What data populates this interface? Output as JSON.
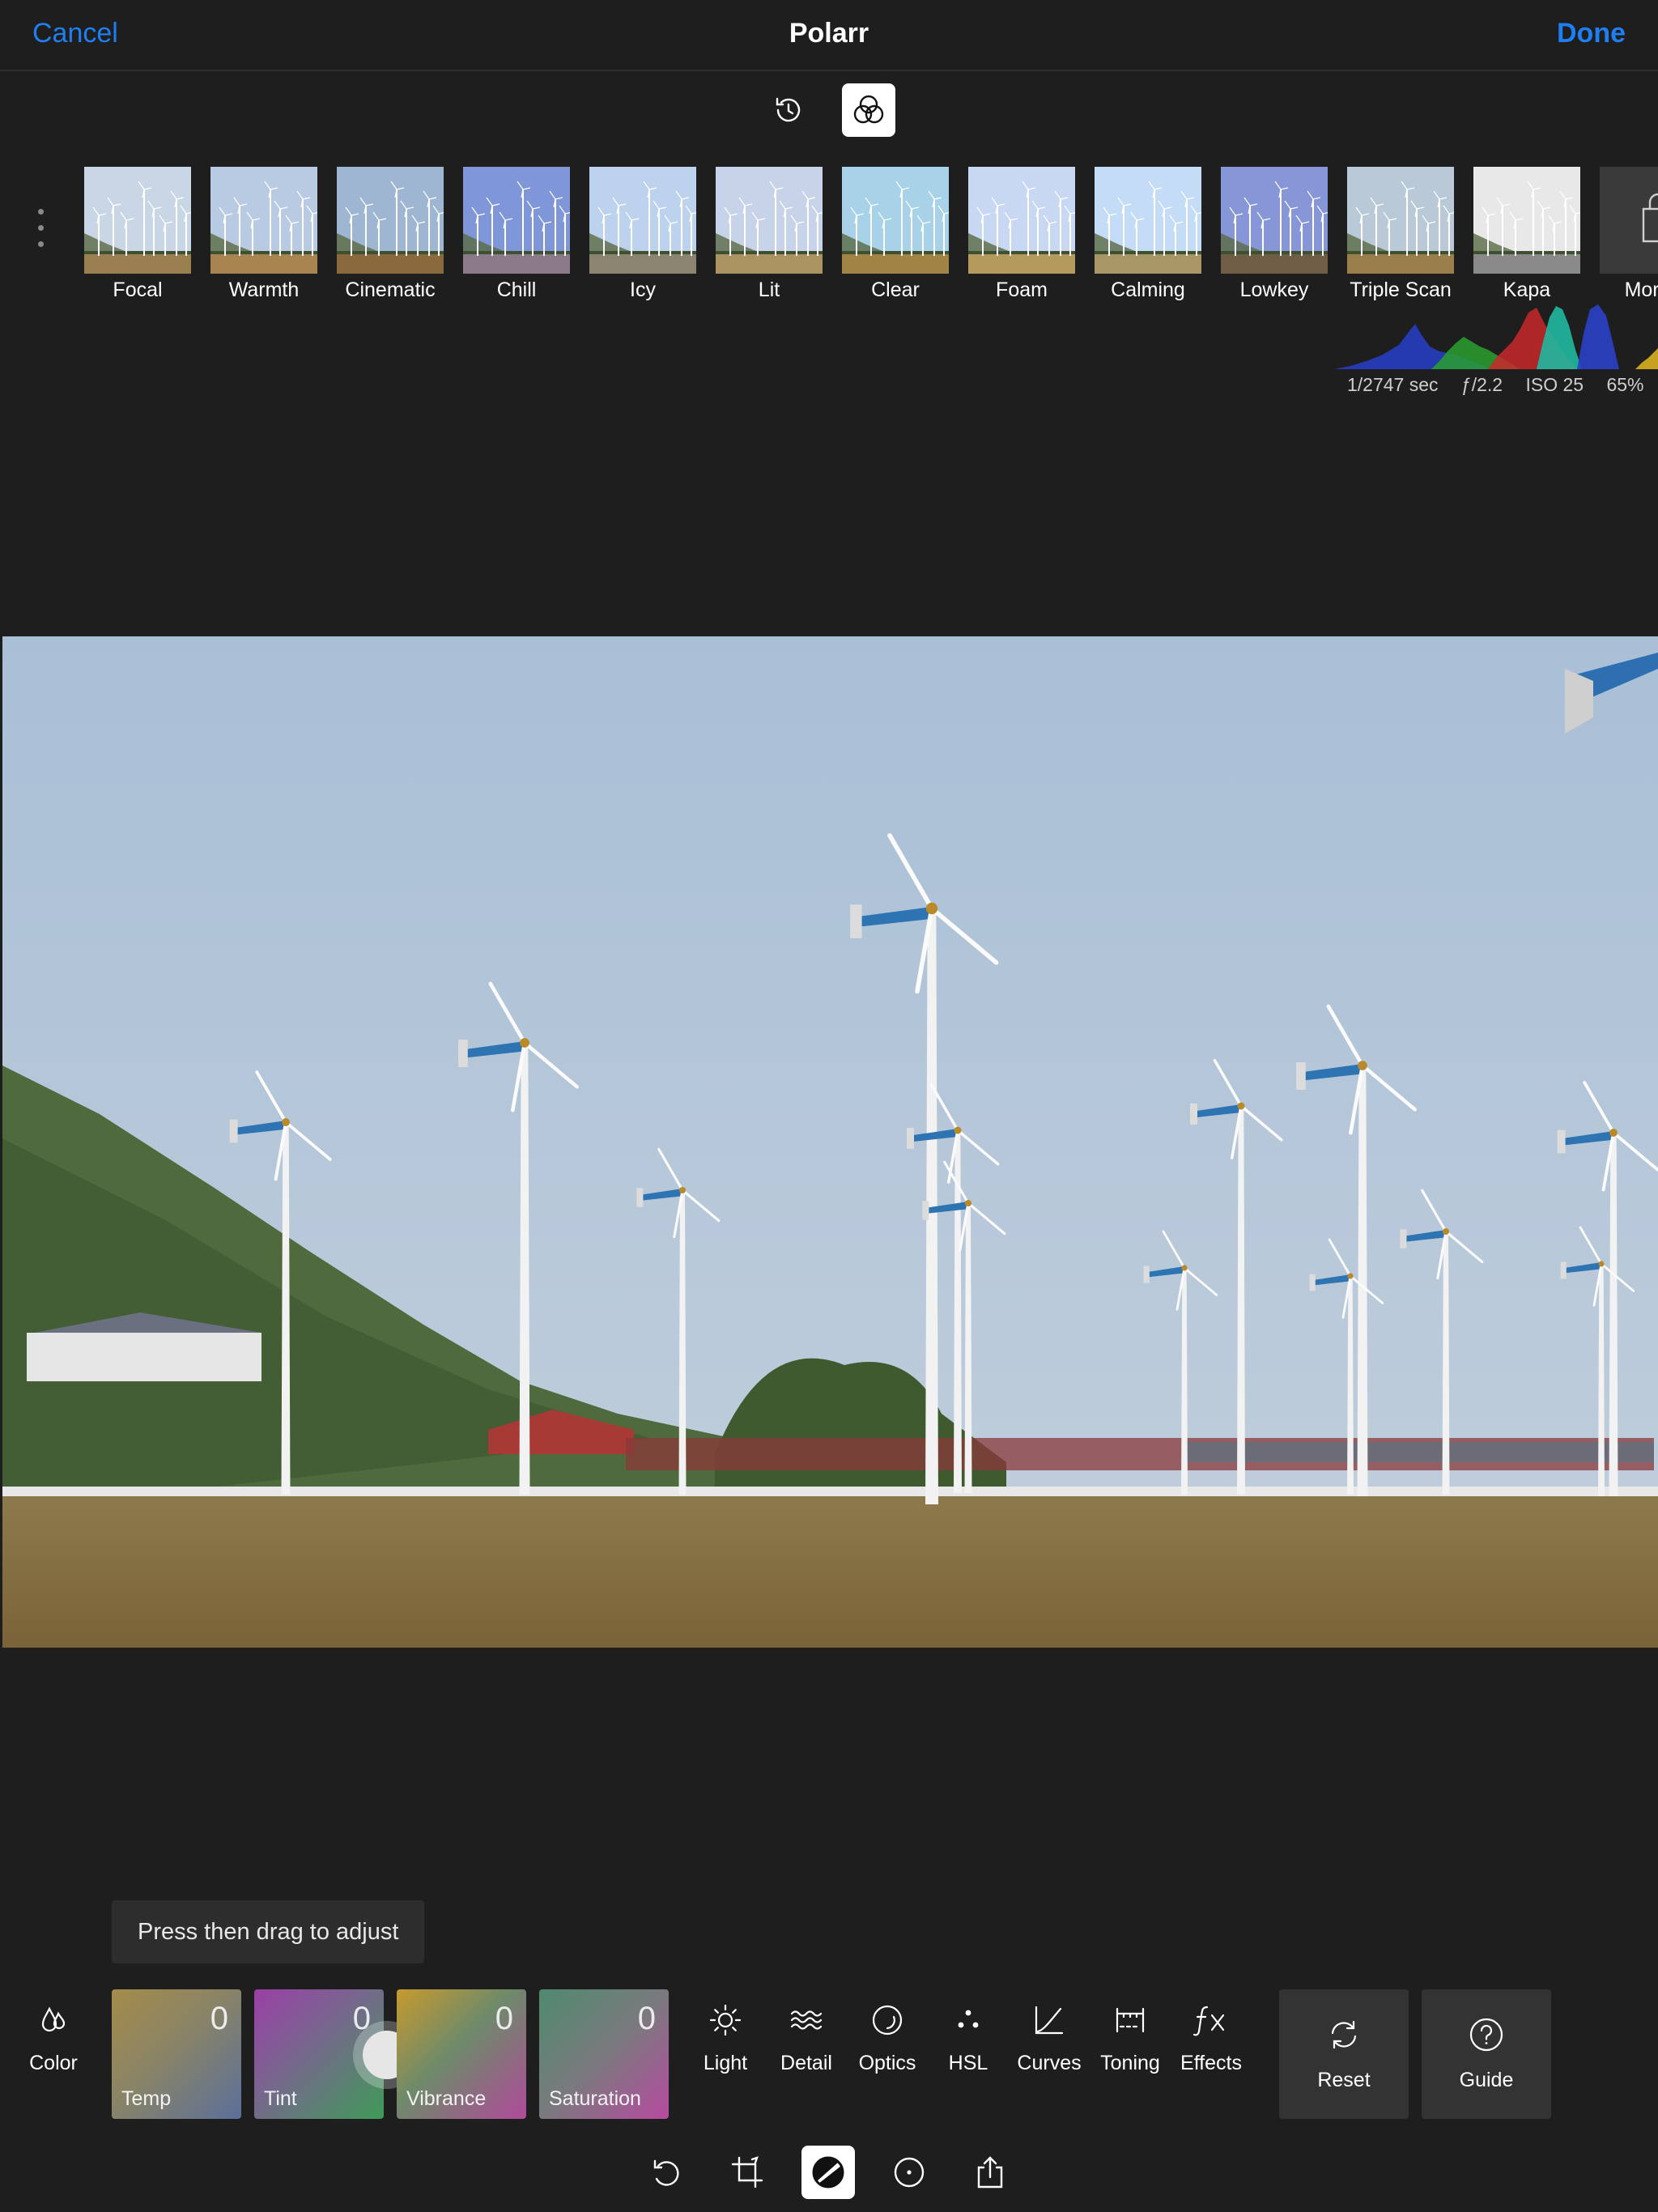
{
  "nav": {
    "cancel": "Cancel",
    "title": "Polarr",
    "done": "Done"
  },
  "top_tools": [
    {
      "name": "history-icon"
    },
    {
      "name": "filters-icon",
      "active": true
    }
  ],
  "filters": [
    {
      "label": "Focal",
      "sky": "#c9d6e6",
      "ground": "#9a8050"
    },
    {
      "label": "Warmth",
      "sky": "#b9cbe2",
      "ground": "#a88450"
    },
    {
      "label": "Cinematic",
      "sky": "#9eb6d2",
      "ground": "#8a6a3c"
    },
    {
      "label": "Chill",
      "sky": "#7f96d8",
      "ground": "#8c7a8a"
    },
    {
      "label": "Icy",
      "sky": "#bdd2ec",
      "ground": "#8a8470"
    },
    {
      "label": "Lit",
      "sky": "#c7d3e8",
      "ground": "#ab9462"
    },
    {
      "label": "Clear",
      "sky": "#a7d2e8",
      "ground": "#a28346"
    },
    {
      "label": "Foam",
      "sky": "#c9d8f2",
      "ground": "#b59a5e"
    },
    {
      "label": "Calming",
      "sky": "#c4dcf6",
      "ground": "#a99666"
    },
    {
      "label": "Lowkey",
      "sky": "#8796d6",
      "ground": "#6f5d46"
    },
    {
      "label": "Triple Scan",
      "sky": "#b9c9d8",
      "ground": "#9a7f4c"
    },
    {
      "label": "Kapa",
      "sky": "#e8e8e8",
      "ground": "#8a8a8a"
    },
    {
      "label": "More f",
      "sky": "#3a3a3a",
      "ground": "#3a3a3a"
    }
  ],
  "exif": {
    "shutter": "1/2747 sec",
    "aperture": "ƒ/2.2",
    "iso": "ISO 25",
    "zoom": "65%"
  },
  "hint": "Press then drag to adjust",
  "color_tool": {
    "label": "Color"
  },
  "sliders": [
    {
      "label": "Temp",
      "value": "0"
    },
    {
      "label": "Tint",
      "value": "0"
    },
    {
      "label": "Vibrance",
      "value": "0"
    },
    {
      "label": "Saturation",
      "value": "0"
    }
  ],
  "tools": [
    {
      "label": "Light",
      "icon": "sun-icon"
    },
    {
      "label": "Detail",
      "icon": "waves-icon"
    },
    {
      "label": "Optics",
      "icon": "lens-icon"
    },
    {
      "label": "HSL",
      "icon": "dots-icon"
    },
    {
      "label": "Curves",
      "icon": "curve-icon"
    },
    {
      "label": "Toning",
      "icon": "toning-icon"
    },
    {
      "label": "Effects",
      "icon": "fx-icon"
    }
  ],
  "actions": {
    "reset": "Reset",
    "guide": "Guide"
  },
  "bottom_modes": [
    {
      "name": "undo-icon"
    },
    {
      "name": "crop-icon"
    },
    {
      "name": "adjust-icon",
      "active": true
    },
    {
      "name": "local-adjust-icon"
    },
    {
      "name": "share-icon"
    }
  ],
  "colors": {
    "accent": "#1f7ff0",
    "background": "#1e1e1e",
    "panel": "#333333"
  }
}
